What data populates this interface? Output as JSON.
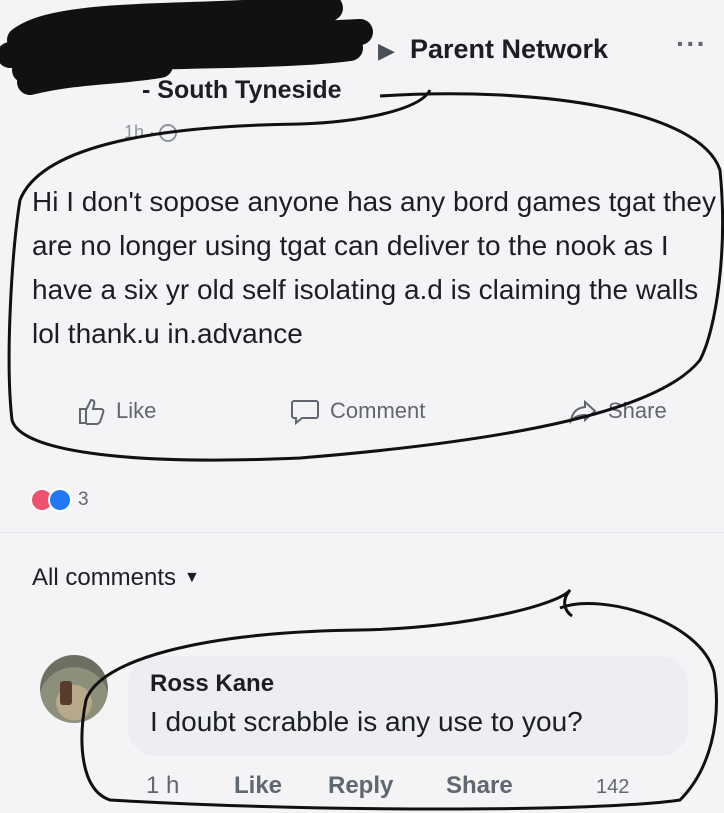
{
  "post": {
    "group_name": "Parent Network",
    "group_subtitle": "- South Tyneside",
    "timestamp": "1h ·",
    "body": "Hi I don't sopose anyone has any bord games tgat they are no longer using tgat can deliver to the nook as I have a six yr old self isolating a.d is claiming the walls lol  thank.u in.advance"
  },
  "actions": {
    "like": "Like",
    "comment": "Comment",
    "share": "Share"
  },
  "reactions": {
    "count": "3"
  },
  "comments": {
    "header": "All comments",
    "items": [
      {
        "author": "Ross Kane",
        "text": "I doubt scrabble is any use to you?",
        "time": "1 h",
        "like": "Like",
        "reply": "Reply",
        "share": "Share",
        "count": "142"
      }
    ]
  },
  "colors": {
    "text": "#1c1e21",
    "secondary": "#606770",
    "love": "#f0506e",
    "like": "#2078f4",
    "bubble": "#eceef2"
  }
}
